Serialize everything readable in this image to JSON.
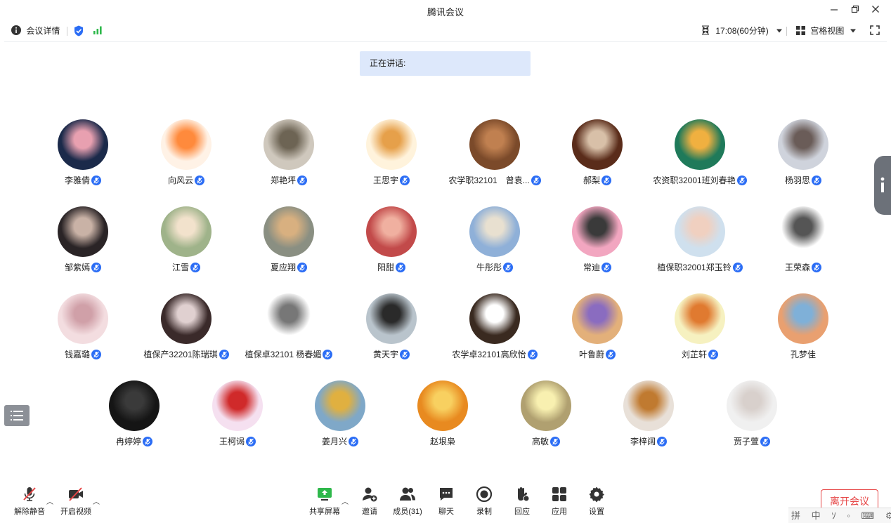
{
  "window": {
    "title": "腾讯会议",
    "controls": [
      "minimize-icon",
      "restore-icon",
      "close-icon"
    ]
  },
  "infobar": {
    "meeting_details": "会议详情",
    "time": "17:08(60分钟)",
    "view_mode": "宫格视图"
  },
  "speaking_label": "正在讲话:",
  "colors": {
    "accent": "#2b6df5",
    "leave": "#e64545",
    "speaking_bg": "#dde8fb",
    "signal": "#2eb84b"
  },
  "participants": [
    {
      "name": "李雅倩",
      "mic": true
    },
    {
      "name": "向风云",
      "mic": true
    },
    {
      "name": "郑艳坪",
      "mic": true
    },
    {
      "name": "王思宇",
      "mic": true
    },
    {
      "name": "农学职32101　曾袁...",
      "mic": true
    },
    {
      "name": "郝梨",
      "mic": true
    },
    {
      "name": "农资职32001班刘春艳",
      "mic": true
    },
    {
      "name": "杨羽思",
      "mic": true
    },
    {
      "name": "邹紫嫣",
      "mic": true
    },
    {
      "name": "江雪",
      "mic": true
    },
    {
      "name": "夏应翔",
      "mic": true
    },
    {
      "name": "阳甜",
      "mic": true
    },
    {
      "name": "牛彤彤",
      "mic": true
    },
    {
      "name": "常迪",
      "mic": true
    },
    {
      "name": "植保职32001郑玉铃",
      "mic": true
    },
    {
      "name": "王荣森",
      "mic": true
    },
    {
      "name": "钱嘉璐",
      "mic": true
    },
    {
      "name": "植保产32201陈瑞琪",
      "mic": true
    },
    {
      "name": "植保卓32101 杨春媚",
      "mic": true
    },
    {
      "name": "黄天宇",
      "mic": true
    },
    {
      "name": "农学卓32101高欣怡",
      "mic": true
    },
    {
      "name": "叶鲁蔚",
      "mic": true
    },
    {
      "name": "刘芷轩",
      "mic": true
    },
    {
      "name": "孔梦佳",
      "mic": false
    },
    {
      "name": "冉婷婷",
      "mic": true
    },
    {
      "name": "王柯谒",
      "mic": true
    },
    {
      "name": "姜月兴",
      "mic": true
    },
    {
      "name": "赵垠枭",
      "mic": false
    },
    {
      "name": "高敏",
      "mic": true
    },
    {
      "name": "李梓阔",
      "mic": true
    },
    {
      "name": "贾子萱",
      "mic": true
    }
  ],
  "toolbar": {
    "unmute": "解除静音",
    "start_video": "开启视频",
    "share_screen": "共享屏幕",
    "invite": "邀请",
    "members": "成员(31)",
    "chat": "聊天",
    "record": "录制",
    "reactions": "回应",
    "apps": "应用",
    "settings": "设置",
    "leave": "离开会议"
  },
  "ime_bar": "拼 中 ｿ ◦ ⌨ ⚙ ⁝"
}
